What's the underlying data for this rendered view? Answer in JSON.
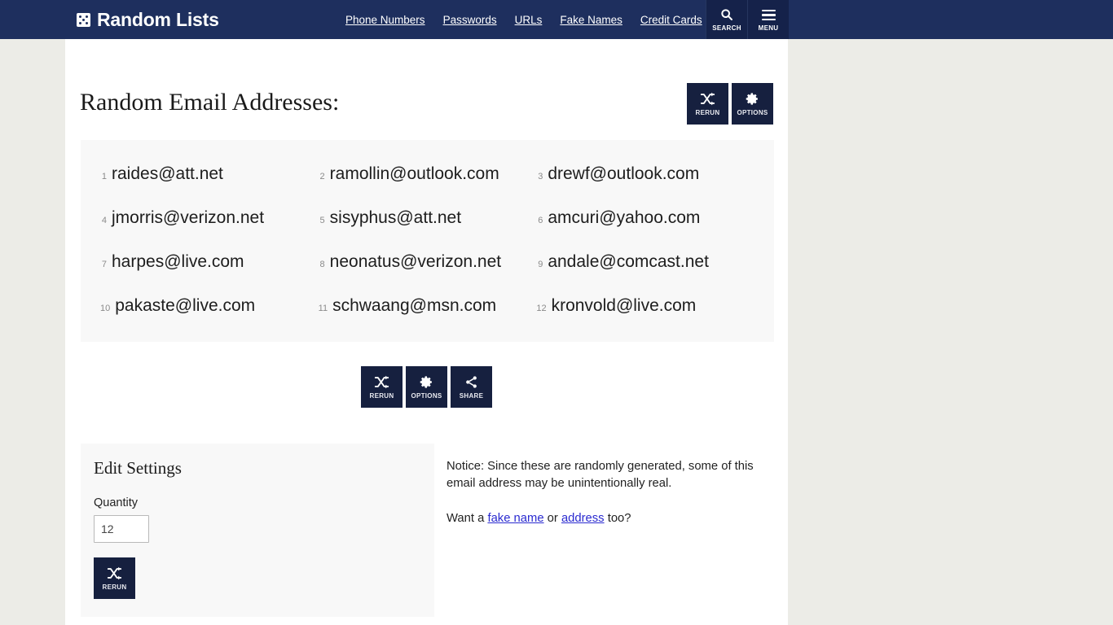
{
  "header": {
    "logo_icon": "dice-icon",
    "brand": "Random Lists",
    "nav": [
      {
        "label": "Phone Numbers"
      },
      {
        "label": "Passwords"
      },
      {
        "label": "URLs"
      },
      {
        "label": "Fake Names"
      },
      {
        "label": "Credit Cards"
      }
    ],
    "search": {
      "icon": "search-icon",
      "label": "SEARCH"
    },
    "menu": {
      "icon": "hamburger-menu-icon",
      "label": "MENU"
    },
    "bg_color": "#1e2f5e",
    "button_bg_color": "#15224a"
  },
  "main": {
    "title": "Random Email Addresses:",
    "top_actions": [
      {
        "icon": "shuffle-icon",
        "label": "RERUN"
      },
      {
        "icon": "gear-icon",
        "label": "OPTIONS"
      }
    ],
    "center_actions": [
      {
        "icon": "shuffle-icon",
        "label": "RERUN"
      },
      {
        "icon": "gear-icon",
        "label": "OPTIONS"
      },
      {
        "icon": "share-icon",
        "label": "SHARE"
      }
    ],
    "results": [
      {
        "num": "1",
        "email": "raides@att.net"
      },
      {
        "num": "2",
        "email": "ramollin@outlook.com"
      },
      {
        "num": "3",
        "email": "drewf@outlook.com"
      },
      {
        "num": "4",
        "email": "jmorris@verizon.net"
      },
      {
        "num": "5",
        "email": "sisyphus@att.net"
      },
      {
        "num": "6",
        "email": "amcuri@yahoo.com"
      },
      {
        "num": "7",
        "email": "harpes@live.com"
      },
      {
        "num": "8",
        "email": "neonatus@verizon.net"
      },
      {
        "num": "9",
        "email": "andale@comcast.net"
      },
      {
        "num": "10",
        "email": "pakaste@live.com"
      },
      {
        "num": "11",
        "email": "schwaang@msn.com"
      },
      {
        "num": "12",
        "email": "kronvold@live.com"
      }
    ]
  },
  "settings": {
    "heading": "Edit Settings",
    "quantity_label": "Quantity",
    "quantity_value": "12",
    "quantity_placeholder": "",
    "rerun": {
      "icon": "shuffle-icon",
      "label": "RERUN"
    }
  },
  "notice": {
    "line1": "Notice: Since these are randomly generated, some of this email address may be unintentionally real.",
    "want_prefix": "Want a ",
    "link_fake_name": "fake name",
    "want_middle": " or ",
    "link_address": "address",
    "want_suffix": " too?"
  },
  "theme": {
    "page_bg": "#ecece7",
    "content_bg": "#ffffff",
    "panel_bg": "#f8f8f8",
    "action_bg": "#16203f",
    "link_color": "#2a2ad0"
  }
}
